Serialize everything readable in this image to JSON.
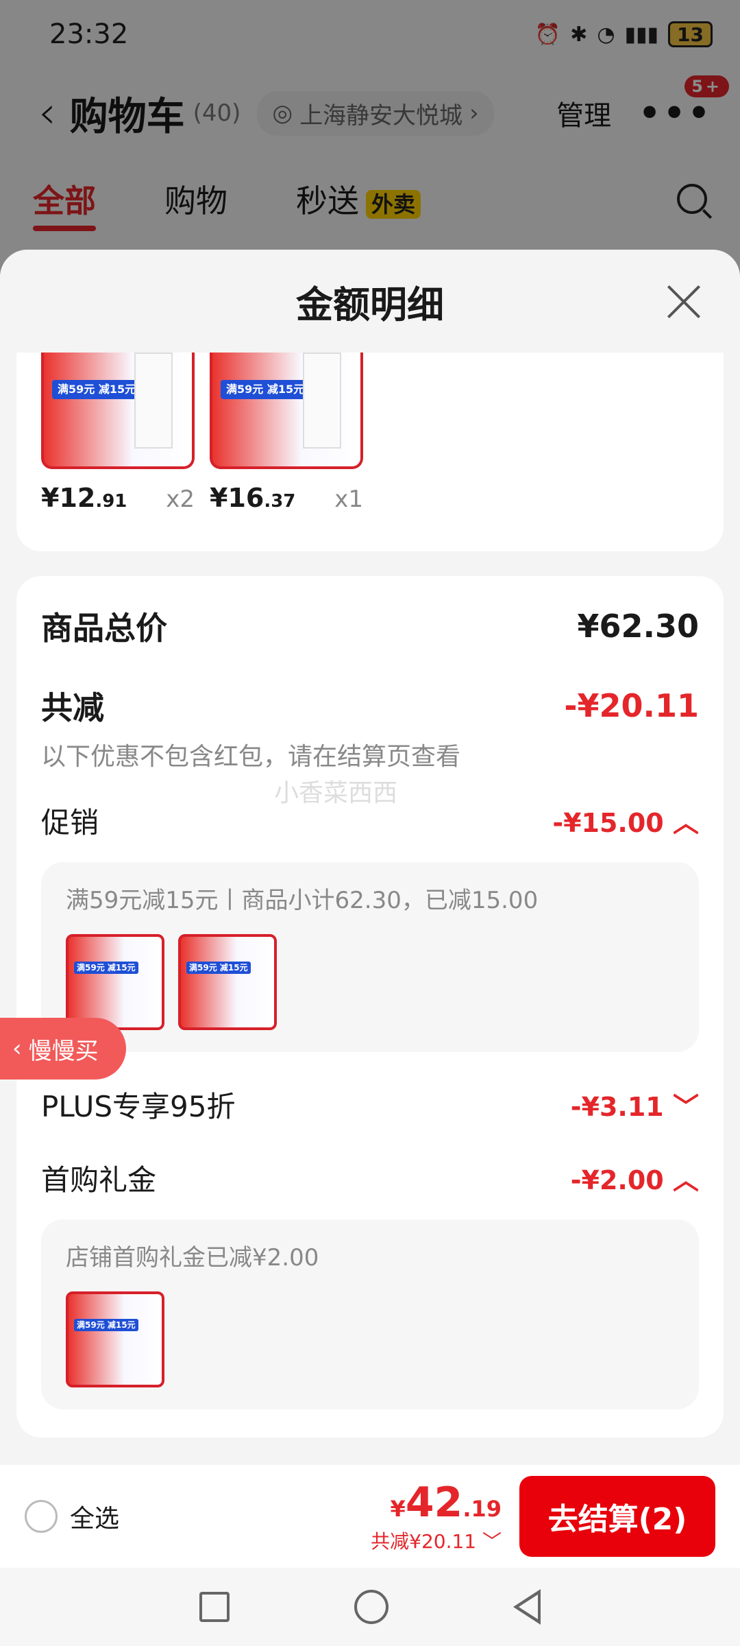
{
  "status": {
    "time": "23:32",
    "battery": "13"
  },
  "header": {
    "back": "‹",
    "title": "购物车",
    "count": "(40)",
    "location": "上海静安大悦城",
    "manage": "管理",
    "more_badge": "5+"
  },
  "tabs": [
    {
      "label": "全部"
    },
    {
      "label": "购物"
    },
    {
      "label": "秒送"
    }
  ],
  "tabs_tag": "外卖",
  "sheet": {
    "title": "金额明细",
    "products": [
      {
        "price_int": "¥12",
        "price_dec": ".91",
        "qty": "x2",
        "promo": "满59元 减15元"
      },
      {
        "price_int": "¥16",
        "price_dec": ".37",
        "qty": "x1",
        "promo": "满59元 减15元"
      }
    ],
    "total_label": "商品总价",
    "total_value": "¥62.30",
    "discount_label": "共减",
    "discount_value": "-¥20.11",
    "discount_note": "以下优惠不包含红包，请在结算页查看",
    "promo_label": "促销",
    "promo_value": "-¥15.00",
    "promo_detail": "满59元减15元丨商品小计62.30，已减15.00",
    "plus_label": "PLUS专享95折",
    "plus_value": "-¥3.11",
    "gift_label": "首购礼金",
    "gift_value": "-¥2.00",
    "gift_detail": "店铺首购礼金已减¥2.00",
    "watermark": "小香菜西西"
  },
  "floater": "慢慢买",
  "bottom": {
    "select_all": "全选",
    "currency": "¥",
    "total_int": "42",
    "total_dec": ".19",
    "saved": "共减¥20.11 ﹀",
    "checkout": "去结算(2)"
  }
}
